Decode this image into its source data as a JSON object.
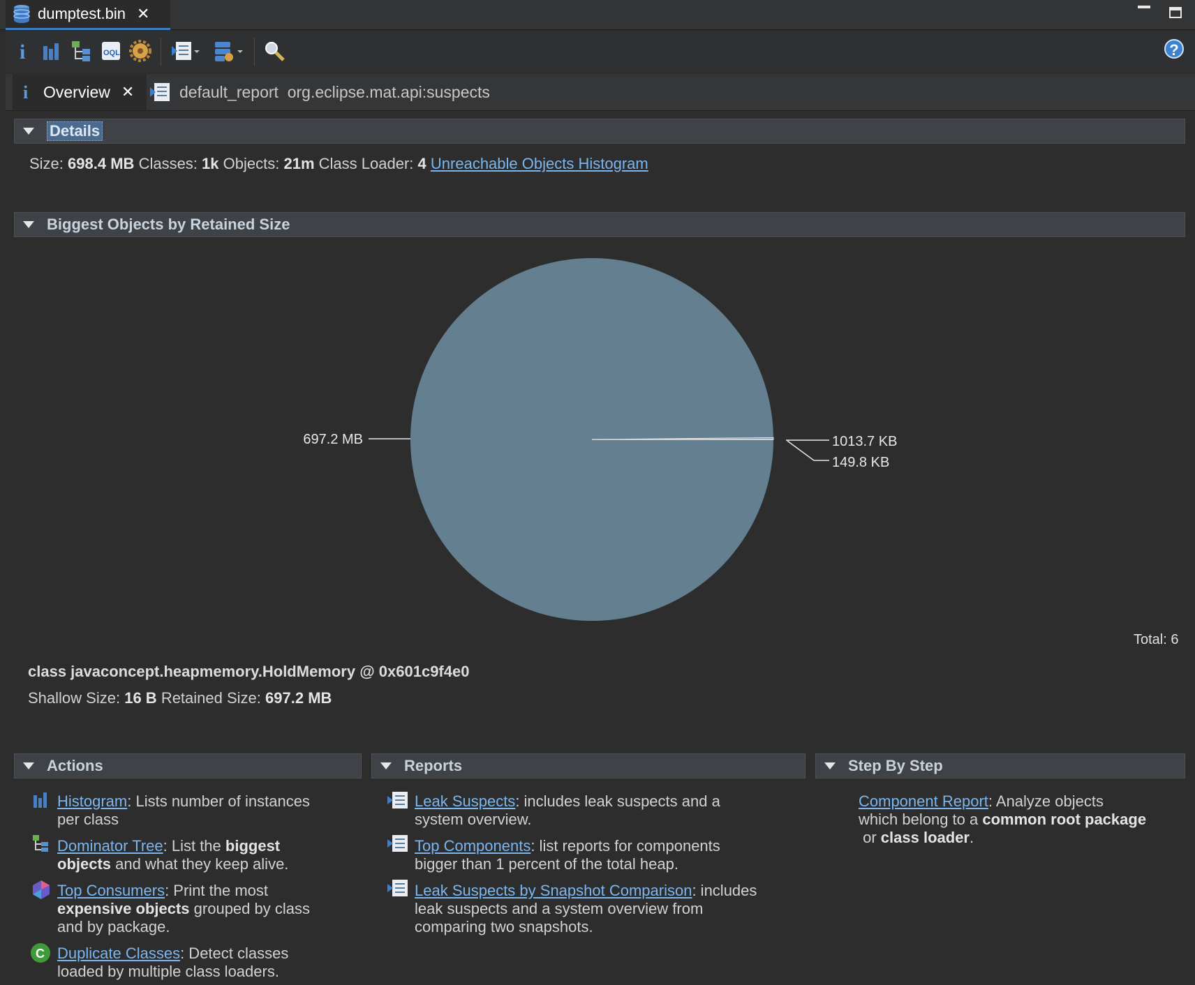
{
  "editor_tab": {
    "title": "dumptest.bin"
  },
  "inner_tabs": [
    {
      "label": "Overview"
    },
    {
      "label": "default_report  org.eclipse.mat.api:suspects"
    }
  ],
  "details": {
    "header": "Details",
    "size_label": "Size:",
    "size_value": "698.4 MB",
    "classes_label": "Classes:",
    "classes_value": "1k",
    "objects_label": "Objects:",
    "objects_value": "21m",
    "classloader_label": "Class Loader:",
    "classloader_value": "4",
    "unreachable_link": "Unreachable Objects Histogram"
  },
  "biggest": {
    "header": "Biggest Objects by Retained Size",
    "total_label": "Total: 6",
    "selected_class": "class javaconcept.heapmemory.HoldMemory @ 0x601c9f4e0",
    "shallow_label": "Shallow Size:",
    "shallow_value": "16 B",
    "retained_label": "Retained Size:",
    "retained_value": "697.2 MB"
  },
  "chart_data": {
    "type": "pie",
    "unit": "KB",
    "labels": [
      "697.2 MB",
      "1013.7 KB",
      "149.8 KB"
    ],
    "values": [
      713932.8,
      1013.7,
      149.8
    ],
    "colors": [
      "#647f90",
      "#7f8f9a",
      "#8c9aa4"
    ]
  },
  "actions": {
    "header": "Actions",
    "items": [
      {
        "link": "Histogram",
        "t1": ": Lists number of instances",
        "t2": "per class"
      },
      {
        "link": "Dominator Tree",
        "t1": ": List the ",
        "b1": "biggest",
        "b2": "objects",
        "t2": " and what they keep alive."
      },
      {
        "link": "Top Consumers",
        "t1": ": Print the most",
        "b1": "expensive objects",
        "t2": " grouped by class",
        "t3": "and by package."
      },
      {
        "link": "Duplicate Classes",
        "t1": ": Detect classes",
        "t2": "loaded by multiple class loaders."
      }
    ]
  },
  "reports": {
    "header": "Reports",
    "items": [
      {
        "link": "Leak Suspects",
        "t1": ": includes leak suspects and a",
        "t2": "system overview."
      },
      {
        "link": "Top Components",
        "t1": ": list reports for components",
        "t2": "bigger than 1 percent of the total heap."
      },
      {
        "link": "Leak Suspects by Snapshot Comparison",
        "t1": ": includes",
        "t2": "leak suspects and a system overview from",
        "t3": "comparing two snapshots."
      }
    ]
  },
  "stepbystep": {
    "header": "Step By Step",
    "item": {
      "link": "Component Report",
      "t1": ": Analyze objects",
      "t2": "which belong to a ",
      "b1": "common root package",
      "t3": " or ",
      "b2": "class loader",
      "t4": "."
    }
  },
  "colors": {
    "accent": "#3d7fc1",
    "link": "#7ab7f0",
    "pie": "#647f90"
  },
  "icons": [
    "database-icon",
    "info-icon",
    "histogram-icon",
    "dominator-tree-icon",
    "oql-icon",
    "gear-icon",
    "report-icon",
    "query-icon",
    "search-icon",
    "help-icon"
  ]
}
